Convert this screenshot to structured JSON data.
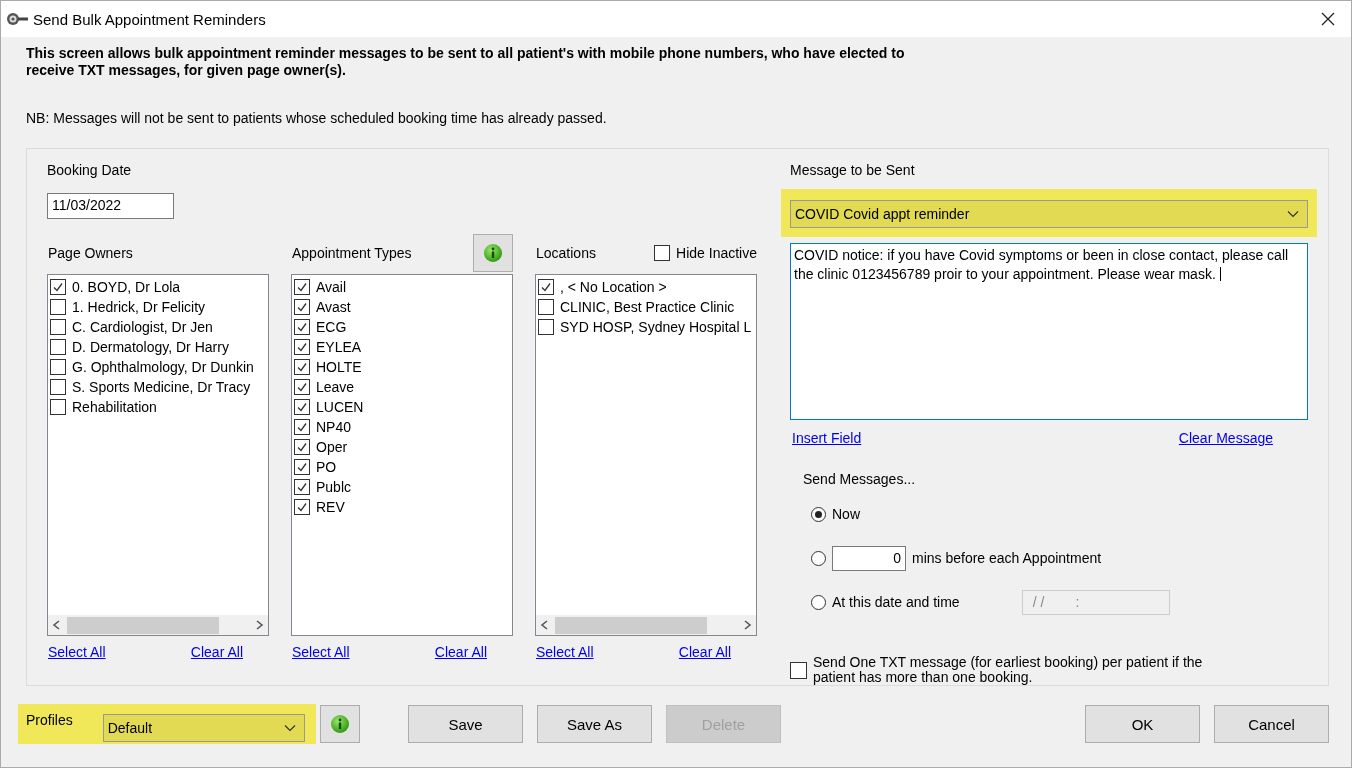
{
  "window": {
    "title": "Send Bulk Appointment Reminders"
  },
  "description": "This screen allows bulk appointment reminder messages to be sent to all patient's with mobile phone numbers, who have elected to receive TXT messages, for given page owner(s).",
  "note": "NB: Messages will not be sent  to patients whose scheduled booking time has already passed.",
  "booking_date": {
    "label": "Booking Date",
    "value": "11/03/2022"
  },
  "lists": [
    {
      "header": "Page Owners",
      "scrollbar": true,
      "select_all": "Select All",
      "clear_all": "Clear All",
      "items": [
        {
          "label": "0. BOYD, Dr Lola",
          "checked": true
        },
        {
          "label": "1. Hedrick, Dr Felicity",
          "checked": false
        },
        {
          "label": "C. Cardiologist, Dr Jen",
          "checked": false
        },
        {
          "label": "D. Dermatology, Dr Harry",
          "checked": false
        },
        {
          "label": "G. Ophthalmology, Dr Dunkin",
          "checked": false
        },
        {
          "label": "S. Sports Medicine, Dr Tracy",
          "checked": false
        },
        {
          "label": "Rehabilitation",
          "checked": false
        }
      ]
    },
    {
      "header": "Appointment Types",
      "header_control": {
        "kind": "info_button"
      },
      "scrollbar": false,
      "select_all": "Select All",
      "clear_all": "Clear All",
      "items": [
        {
          "label": "Avail",
          "checked": true
        },
        {
          "label": "Avast",
          "checked": true
        },
        {
          "label": "ECG",
          "checked": true
        },
        {
          "label": "EYLEA",
          "checked": true
        },
        {
          "label": "HOLTE",
          "checked": true
        },
        {
          "label": "Leave",
          "checked": true
        },
        {
          "label": "LUCEN",
          "checked": true
        },
        {
          "label": "NP40",
          "checked": true
        },
        {
          "label": "Oper",
          "checked": true
        },
        {
          "label": "PO",
          "checked": true
        },
        {
          "label": "Publc",
          "checked": true
        },
        {
          "label": "REV",
          "checked": true
        }
      ]
    },
    {
      "header": "Locations",
      "header_control": {
        "kind": "checkbox",
        "label": "Hide Inactive",
        "checked": false
      },
      "scrollbar": true,
      "select_all": "Select All",
      "clear_all": "Clear All",
      "items": [
        {
          "label": ", < No Location >",
          "checked": true
        },
        {
          "label": "CLINIC, Best Practice Clinic",
          "checked": false
        },
        {
          "label": "SYD HOSP, Sydney Hospital L",
          "checked": false
        }
      ]
    }
  ],
  "message": {
    "label": "Message to be Sent",
    "template": "COVID Covid appt reminder",
    "highlighted": true,
    "text": "COVID notice: if you have Covid symptoms or been in close contact, please call the clinic 0123456789 proir to your appointment. Please wear mask. ",
    "insert_field": "Insert Field",
    "clear_message": "Clear Message"
  },
  "send_messages": {
    "label": "Send Messages...",
    "options": [
      {
        "kind": "plain",
        "label": "Now",
        "selected": true
      },
      {
        "kind": "minutes",
        "value": "0",
        "label": "mins before each Appointment",
        "selected": false
      },
      {
        "kind": "datetime",
        "label": "At this date and time",
        "value": "/ /        :",
        "selected": false
      }
    ]
  },
  "one_per_patient": {
    "label": "Send One TXT message (for earliest booking) per patient if the patient has more than one booking.",
    "checked": false
  },
  "profiles": {
    "label": "Profiles",
    "value": "Default",
    "highlighted": true
  },
  "profile_buttons": [
    {
      "label": "Save",
      "disabled": false
    },
    {
      "label": "Save As",
      "disabled": false
    },
    {
      "label": "Delete",
      "disabled": true
    }
  ],
  "dialog_buttons": [
    {
      "label": "OK"
    },
    {
      "label": "Cancel"
    }
  ]
}
